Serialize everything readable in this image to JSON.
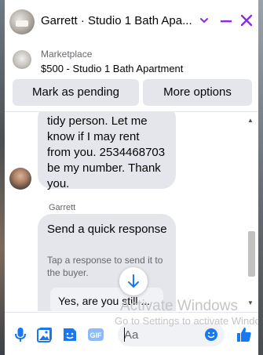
{
  "header": {
    "title": "Garrett · Studio 1 Bath Apa..."
  },
  "listing": {
    "kicker": "Marketplace",
    "description": "$500 - Studio 1 Bath Apartment",
    "mark_pending_label": "Mark as pending",
    "more_options_label": "More options"
  },
  "messages": {
    "incoming_text": "tidy person. Let me\nknow if I may rent\nfrom you. 2534468703\nbe my number. Thank\nyou.",
    "sender": "Garrett",
    "quick_response": {
      "title": "Send a quick response",
      "subtitle": "Tap a response to send it to the buyer.",
      "option": "Yes, are you still ..."
    }
  },
  "composer": {
    "placeholder": "Aa"
  },
  "watermark": {
    "title": "Activate Windows",
    "subtitle": "Go to Settings to activate Windows."
  },
  "colors": {
    "accent": "#8a2be2",
    "messenger_blue": "#1877f2",
    "bubble_gray": "#e4e6eb"
  }
}
